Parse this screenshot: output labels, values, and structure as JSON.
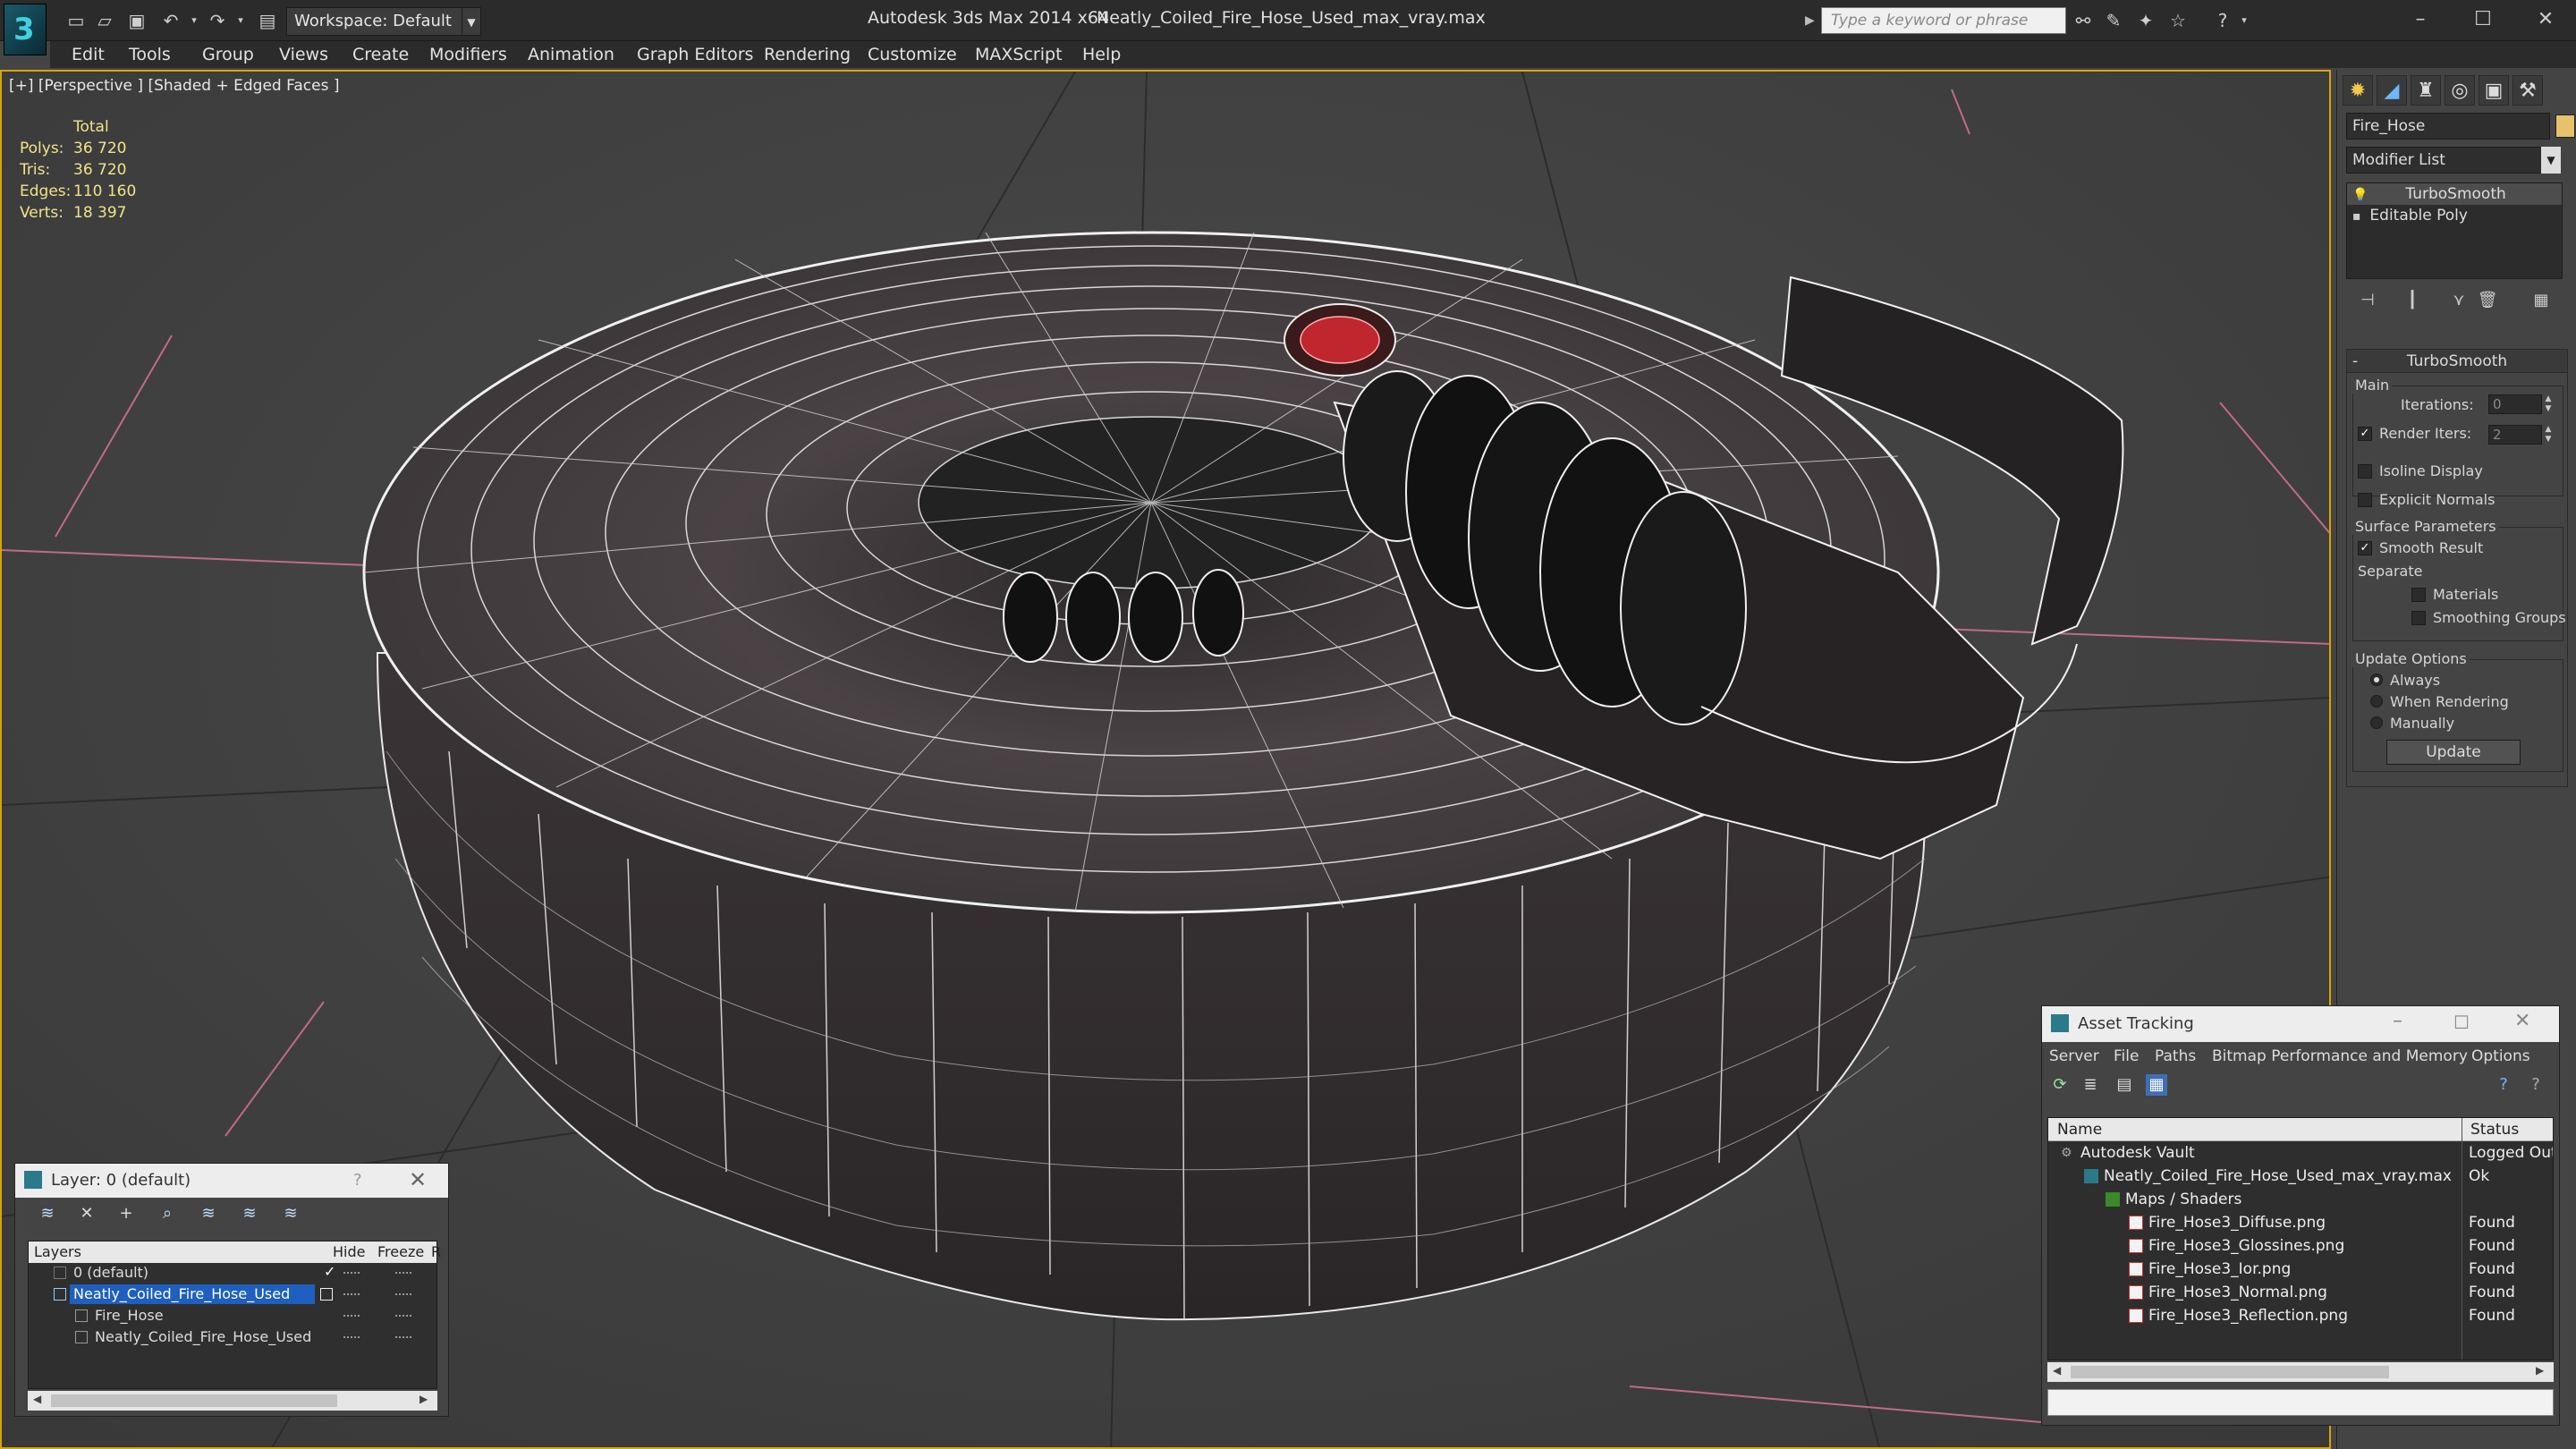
{
  "titlebar": {
    "workspace": "Workspace: Default",
    "app_title": "Autodesk 3ds Max  2014 x64",
    "file_title": "Neatly_Coiled_Fire_Hose_Used_max_vray.max",
    "search_placeholder": "Type a keyword or phrase"
  },
  "menu": [
    "Edit",
    "Tools",
    "Group",
    "Views",
    "Create",
    "Modifiers",
    "Animation",
    "Graph Editors",
    "Rendering",
    "Customize",
    "MAXScript",
    "Help"
  ],
  "viewport": {
    "label": "[+] [Perspective ] [Shaded + Edged Faces ]",
    "stats": {
      "header": "Total",
      "polys_label": "Polys:",
      "polys": "36 720",
      "tris_label": "Tris:",
      "tris": "36 720",
      "edges_label": "Edges:",
      "edges": "110 160",
      "verts_label": "Verts:",
      "verts": "18 397"
    }
  },
  "command_panel": {
    "object_name": "Fire_Hose",
    "object_color": "#e6c26a",
    "modifier_list": "Modifier List",
    "stack": [
      "TurboSmooth",
      "Editable Poly"
    ],
    "rollout_title": "TurboSmooth",
    "main_group": "Main",
    "iterations_label": "Iterations:",
    "iterations": "0",
    "render_iters_label": "Render Iters:",
    "render_iters": "2",
    "isoline": "Isoline Display",
    "explicit_normals": "Explicit Normals",
    "surface_group": "Surface Parameters",
    "smooth_result": "Smooth Result",
    "separate": "Separate",
    "materials": "Materials",
    "smoothing_groups": "Smoothing Groups",
    "update_group": "Update Options",
    "always": "Always",
    "when_rendering": "When Rendering",
    "manually": "Manually",
    "update_btn": "Update"
  },
  "layer_dialog": {
    "title": "Layer: 0 (default)",
    "help": "?",
    "col_layers": "Layers",
    "col_hide": "Hide",
    "col_freeze": "Freeze",
    "col_r": "R",
    "rows": [
      {
        "name": "0 (default)"
      },
      {
        "name": "Neatly_Coiled_Fire_Hose_Used"
      },
      {
        "name": "Fire_Hose"
      },
      {
        "name": "Neatly_Coiled_Fire_Hose_Used"
      }
    ]
  },
  "asset_dialog": {
    "title": "Asset Tracking",
    "menu": [
      "Server",
      "File",
      "Paths",
      "Bitmap Performance and Memory",
      "Options"
    ],
    "col_name": "Name",
    "col_status": "Status",
    "rows": [
      {
        "name": "Autodesk Vault",
        "status": "Logged Out"
      },
      {
        "name": "Neatly_Coiled_Fire_Hose_Used_max_vray.max",
        "status": "Ok"
      },
      {
        "name": "Maps / Shaders",
        "status": ""
      },
      {
        "name": "Fire_Hose3_Diffuse.png",
        "status": "Found"
      },
      {
        "name": "Fire_Hose3_Glossines.png",
        "status": "Found"
      },
      {
        "name": "Fire_Hose3_Ior.png",
        "status": "Found"
      },
      {
        "name": "Fire_Hose3_Normal.png",
        "status": "Found"
      },
      {
        "name": "Fire_Hose3_Reflection.png",
        "status": "Found"
      }
    ]
  }
}
